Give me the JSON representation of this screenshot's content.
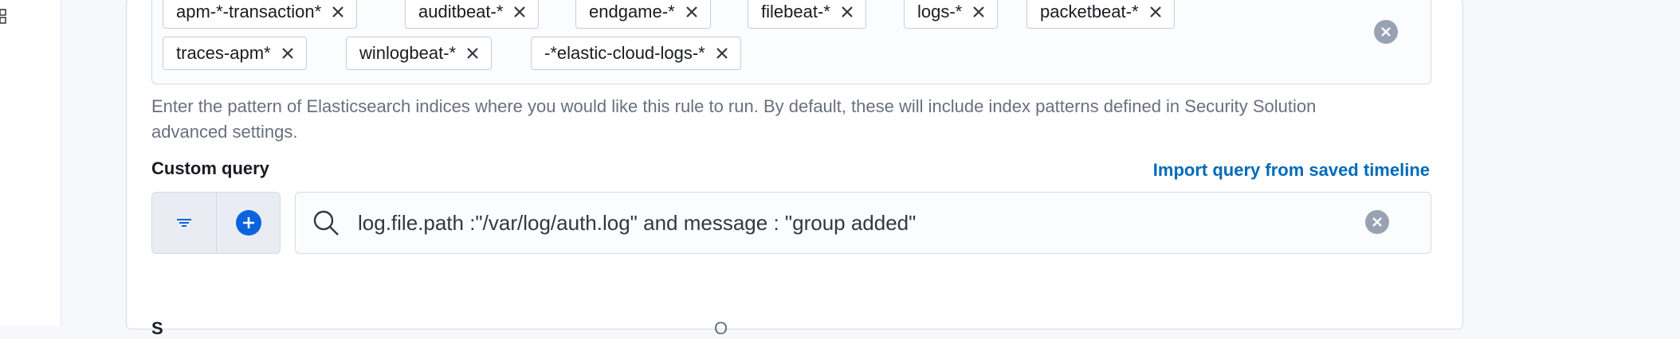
{
  "index_patterns": {
    "pills": [
      "apm-*-transaction*",
      "auditbeat-*",
      "endgame-*",
      "filebeat-*",
      "logs-*",
      "packetbeat-*",
      "traces-apm*",
      "winlogbeat-*",
      "-*elastic-cloud-logs-*"
    ],
    "help_text": "Enter the pattern of Elasticsearch indices where you would like this rule to run. By default, these will include index patterns defined in Security Solution advanced settings."
  },
  "custom_query": {
    "label": "Custom query",
    "import_link": "Import query from saved timeline",
    "query_text": "log.file.path :\"/var/log/auth.log\" and message : \"group added\""
  },
  "next_section": {
    "label": "S",
    "optional": "O"
  },
  "colors": {
    "accent": "#006bb8",
    "primary_button": "#0b64dd",
    "clear_icon": "#98a2b3"
  },
  "icons": [
    "layout-icon",
    "close-icon",
    "clear-icon",
    "filter-icon",
    "add-filter-icon",
    "search-icon"
  ]
}
